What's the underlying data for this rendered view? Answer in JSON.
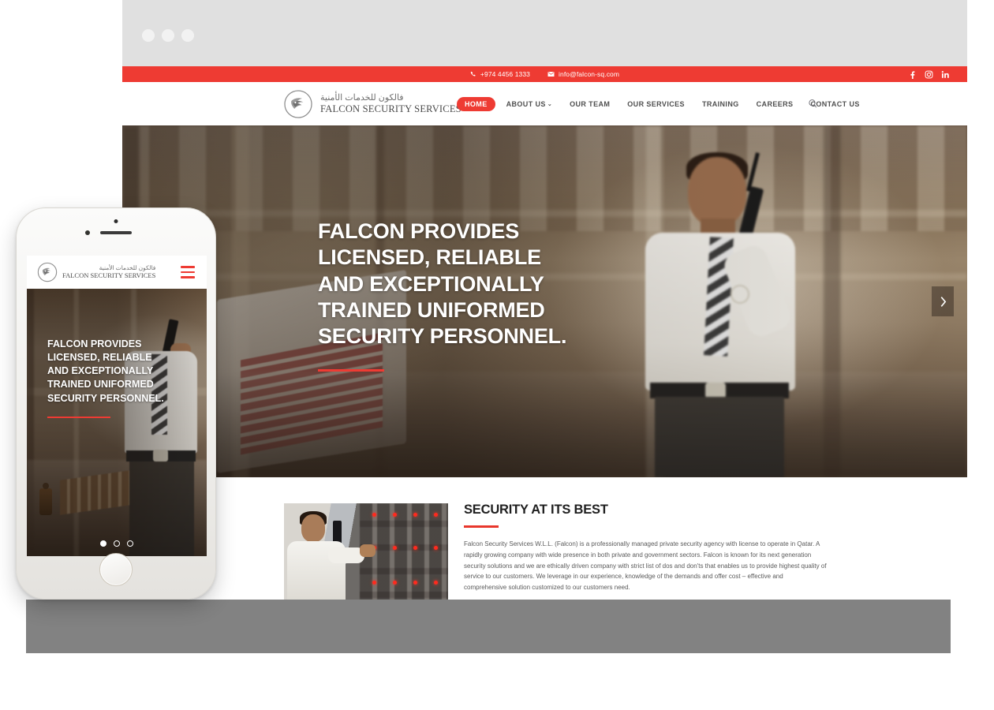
{
  "browser": {
    "dots": [
      "dot-1",
      "dot-2",
      "dot-3"
    ],
    "chrome_bg": "#e0e0e0"
  },
  "brand": {
    "accent_red": "#ee3b33",
    "name_arabic": "فالكون للخدمات الأمنية",
    "name_english": "FALCON SECURITY SERVICES",
    "logo_icon": "falcon-logo-icon"
  },
  "topbar": {
    "phone": "+974 4456 1333",
    "phone_icon": "phone-icon",
    "email": "info@falcon-sq.com",
    "email_icon": "envelope-icon",
    "social": [
      {
        "name": "facebook-icon",
        "label": "f"
      },
      {
        "name": "instagram-icon",
        "label": ""
      },
      {
        "name": "linkedin-icon",
        "label": "in"
      }
    ]
  },
  "nav": {
    "items": [
      {
        "label": "HOME",
        "active": true,
        "has_caret": false
      },
      {
        "label": "ABOUT US",
        "active": false,
        "has_caret": true
      },
      {
        "label": "OUR TEAM",
        "active": false,
        "has_caret": false
      },
      {
        "label": "OUR SERVICES",
        "active": false,
        "has_caret": false
      },
      {
        "label": "TRAINING",
        "active": false,
        "has_caret": false
      },
      {
        "label": "CAREERS",
        "active": false,
        "has_caret": false
      },
      {
        "label": "CONTACT US",
        "active": false,
        "has_caret": false
      }
    ],
    "caret_glyph": "⌄",
    "search_icon": "search-icon"
  },
  "hero": {
    "title": "FALCON PROVIDES LICENSED, RELIABLE AND EXCEPTIONALLY TRAINED UNIFORMED SECURITY PERSONNEL.",
    "next_arrow_icon": "chevron-right-icon",
    "next_arrow_glyph": "›"
  },
  "intro": {
    "heading": "SECURITY AT ITS BEST",
    "body": "Falcon Security Services W.L.L. (Falcon) is a professionally managed private security agency with license to operate in Qatar. A rapidly growing company with wide presence in both private and government sectors. Falcon is known for its next generation security solutions and we are ethically driven company with strict list of dos and don'ts that enables us to provide highest quality of service to our customers. We leverage in our experience, knowledge of the demands and offer cost – effective and comprehensive solution customized to our customers need.",
    "image_alt": "security-guard-with-radio-at-control-panel"
  },
  "phone": {
    "menu_icon": "hamburger-menu-icon",
    "hero_title": "FALCON PROVIDES LICENSED, RELIABLE AND EXCEPTIONALLY TRAINED UNIFORMED SECURITY PERSONNEL.",
    "slider_dots": [
      {
        "active": true
      },
      {
        "active": false
      },
      {
        "active": false
      }
    ],
    "home_button": "home-button"
  }
}
